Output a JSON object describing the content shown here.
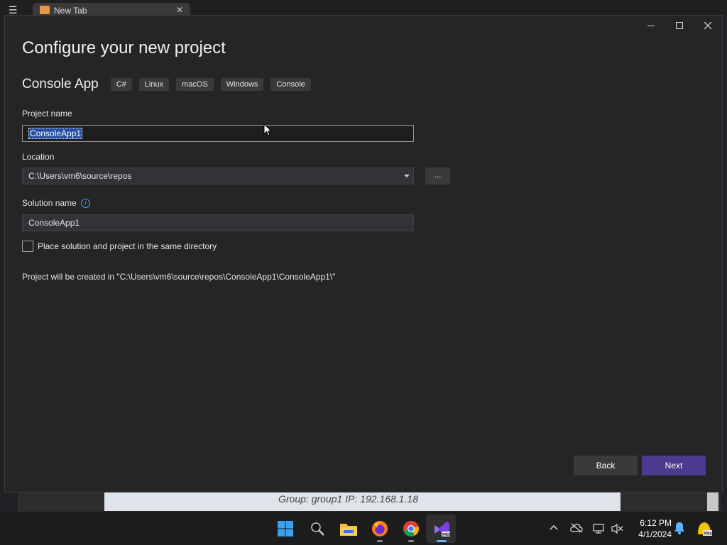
{
  "background_window": {
    "tab_label": "New Tab",
    "status_text": "Group: group1   IP: 192.168.1.18"
  },
  "dialog": {
    "title": "Configure your new project",
    "window_controls": {
      "minimize": "—",
      "maximize": "☐",
      "close": "✕"
    },
    "template": {
      "name": "Console App",
      "tags": [
        "C#",
        "Linux",
        "macOS",
        "Windows",
        "Console"
      ]
    },
    "project_name": {
      "label": "Project name",
      "value": "ConsoleApp1"
    },
    "location": {
      "label": "Location",
      "value": "C:\\Users\\vm6\\source\\repos",
      "browse_label": "..."
    },
    "solution_name": {
      "label": "Solution name",
      "info_icon": "i",
      "value": "ConsoleApp1"
    },
    "same_directory": {
      "label": "Place solution and project in the same directory",
      "checked": false
    },
    "path_note": "Project will be created in \"C:\\Users\\vm6\\source\\repos\\ConsoleApp1\\ConsoleApp1\\\"",
    "buttons": {
      "back": "Back",
      "next": "Next"
    }
  },
  "taskbar": {
    "apps": [
      "windows-start-icon",
      "search-icon",
      "file-explorer-icon",
      "firefox-icon",
      "chrome-icon",
      "visual-studio-preview-icon"
    ],
    "tray": [
      "chevron-up-icon",
      "cloud-offline-icon",
      "network-icon",
      "volume-muted-icon"
    ],
    "time": "6:12 PM",
    "date": "4/1/2024",
    "colors": {
      "accent": "#4b3a8e",
      "selection": "#264f9e"
    }
  }
}
